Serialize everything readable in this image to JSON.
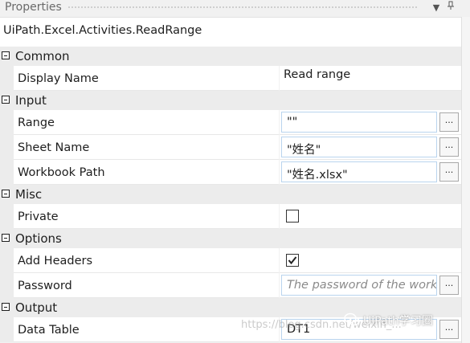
{
  "panel": {
    "title": "Properties"
  },
  "activity": {
    "type": "UiPath.Excel.Activities.ReadRange"
  },
  "categories": [
    {
      "name": "Common",
      "rows": [
        {
          "label": "Display Name",
          "value": "Read range"
        }
      ]
    },
    {
      "name": "Input",
      "rows": [
        {
          "label": "Range",
          "value": "\"\""
        },
        {
          "label": "Sheet Name",
          "value": "\"姓名\""
        },
        {
          "label": "Workbook Path",
          "value": "\"姓名.xlsx\""
        }
      ]
    },
    {
      "name": "Misc",
      "rows": [
        {
          "label": "Private",
          "checked": false
        }
      ]
    },
    {
      "name": "Options",
      "rows": [
        {
          "label": "Add Headers",
          "checked": true
        },
        {
          "label": "Password",
          "placeholder": "The password of the workbook"
        }
      ]
    },
    {
      "name": "Output",
      "rows": [
        {
          "label": "Data Table",
          "value": "DT1"
        }
      ]
    }
  ],
  "ellipsis": "...",
  "watermark": {
    "url": "https://blog.csdn.net/weixin_...",
    "brand": "UiPath学习圈"
  }
}
